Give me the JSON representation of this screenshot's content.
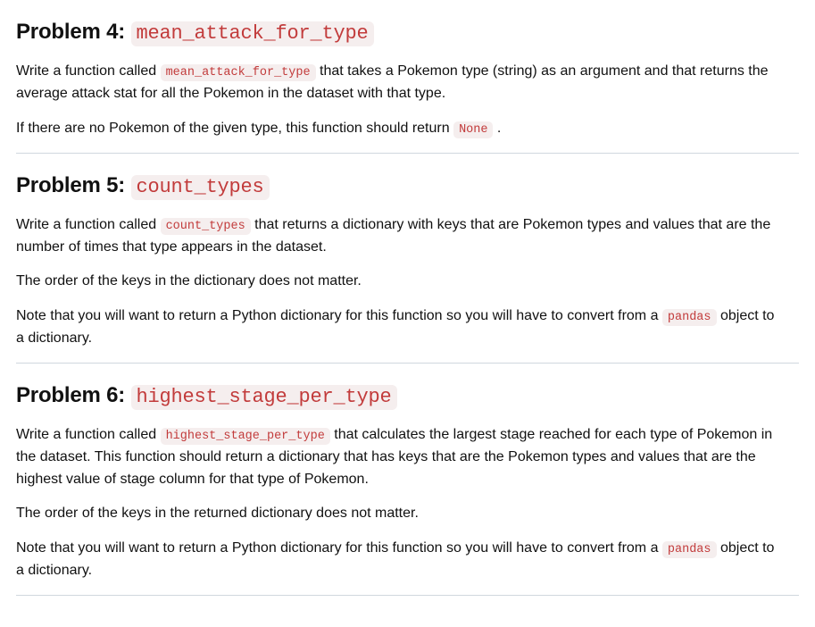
{
  "sections": [
    {
      "heading_prefix": "Problem 4: ",
      "heading_code": "mean_attack_for_type",
      "paragraphs": [
        {
          "parts": [
            {
              "t": "text",
              "v": "Write a function called "
            },
            {
              "t": "code",
              "v": "mean_attack_for_type"
            },
            {
              "t": "text",
              "v": " that takes a Pokemon type (string) as an argument and that returns the average attack stat for all the Pokemon in the dataset with that type."
            }
          ]
        },
        {
          "parts": [
            {
              "t": "text",
              "v": "If there are no Pokemon of the given type, this function should return "
            },
            {
              "t": "code",
              "v": "None"
            },
            {
              "t": "text",
              "v": " ."
            }
          ]
        }
      ]
    },
    {
      "heading_prefix": "Problem 5: ",
      "heading_code": "count_types",
      "paragraphs": [
        {
          "parts": [
            {
              "t": "text",
              "v": "Write a function called "
            },
            {
              "t": "code",
              "v": "count_types"
            },
            {
              "t": "text",
              "v": " that returns a dictionary with keys that are Pokemon types and values that are the number of times that type appears in the dataset."
            }
          ]
        },
        {
          "parts": [
            {
              "t": "text",
              "v": "The order of the keys in the dictionary does not matter."
            }
          ]
        },
        {
          "parts": [
            {
              "t": "text",
              "v": "Note that you will want to return a Python dictionary for this function so you will have to convert from a "
            },
            {
              "t": "code",
              "v": "pandas"
            },
            {
              "t": "text",
              "v": " object to a dictionary."
            }
          ]
        }
      ]
    },
    {
      "heading_prefix": "Problem 6: ",
      "heading_code": "highest_stage_per_type",
      "paragraphs": [
        {
          "parts": [
            {
              "t": "text",
              "v": "Write a function called "
            },
            {
              "t": "code",
              "v": "highest_stage_per_type"
            },
            {
              "t": "text",
              "v": " that calculates the largest stage reached for each type of Pokemon in the dataset. This function should return a dictionary that has keys that are the Pokemon types and values that are the highest value of stage column for that type of Pokemon."
            }
          ]
        },
        {
          "parts": [
            {
              "t": "text",
              "v": "The order of the keys in the returned dictionary does not matter."
            }
          ]
        },
        {
          "parts": [
            {
              "t": "text",
              "v": "Note that you will want to return a Python dictionary for this function so you will have to convert from a "
            },
            {
              "t": "code",
              "v": "pandas"
            },
            {
              "t": "text",
              "v": " object to a dictionary."
            }
          ]
        }
      ]
    }
  ]
}
